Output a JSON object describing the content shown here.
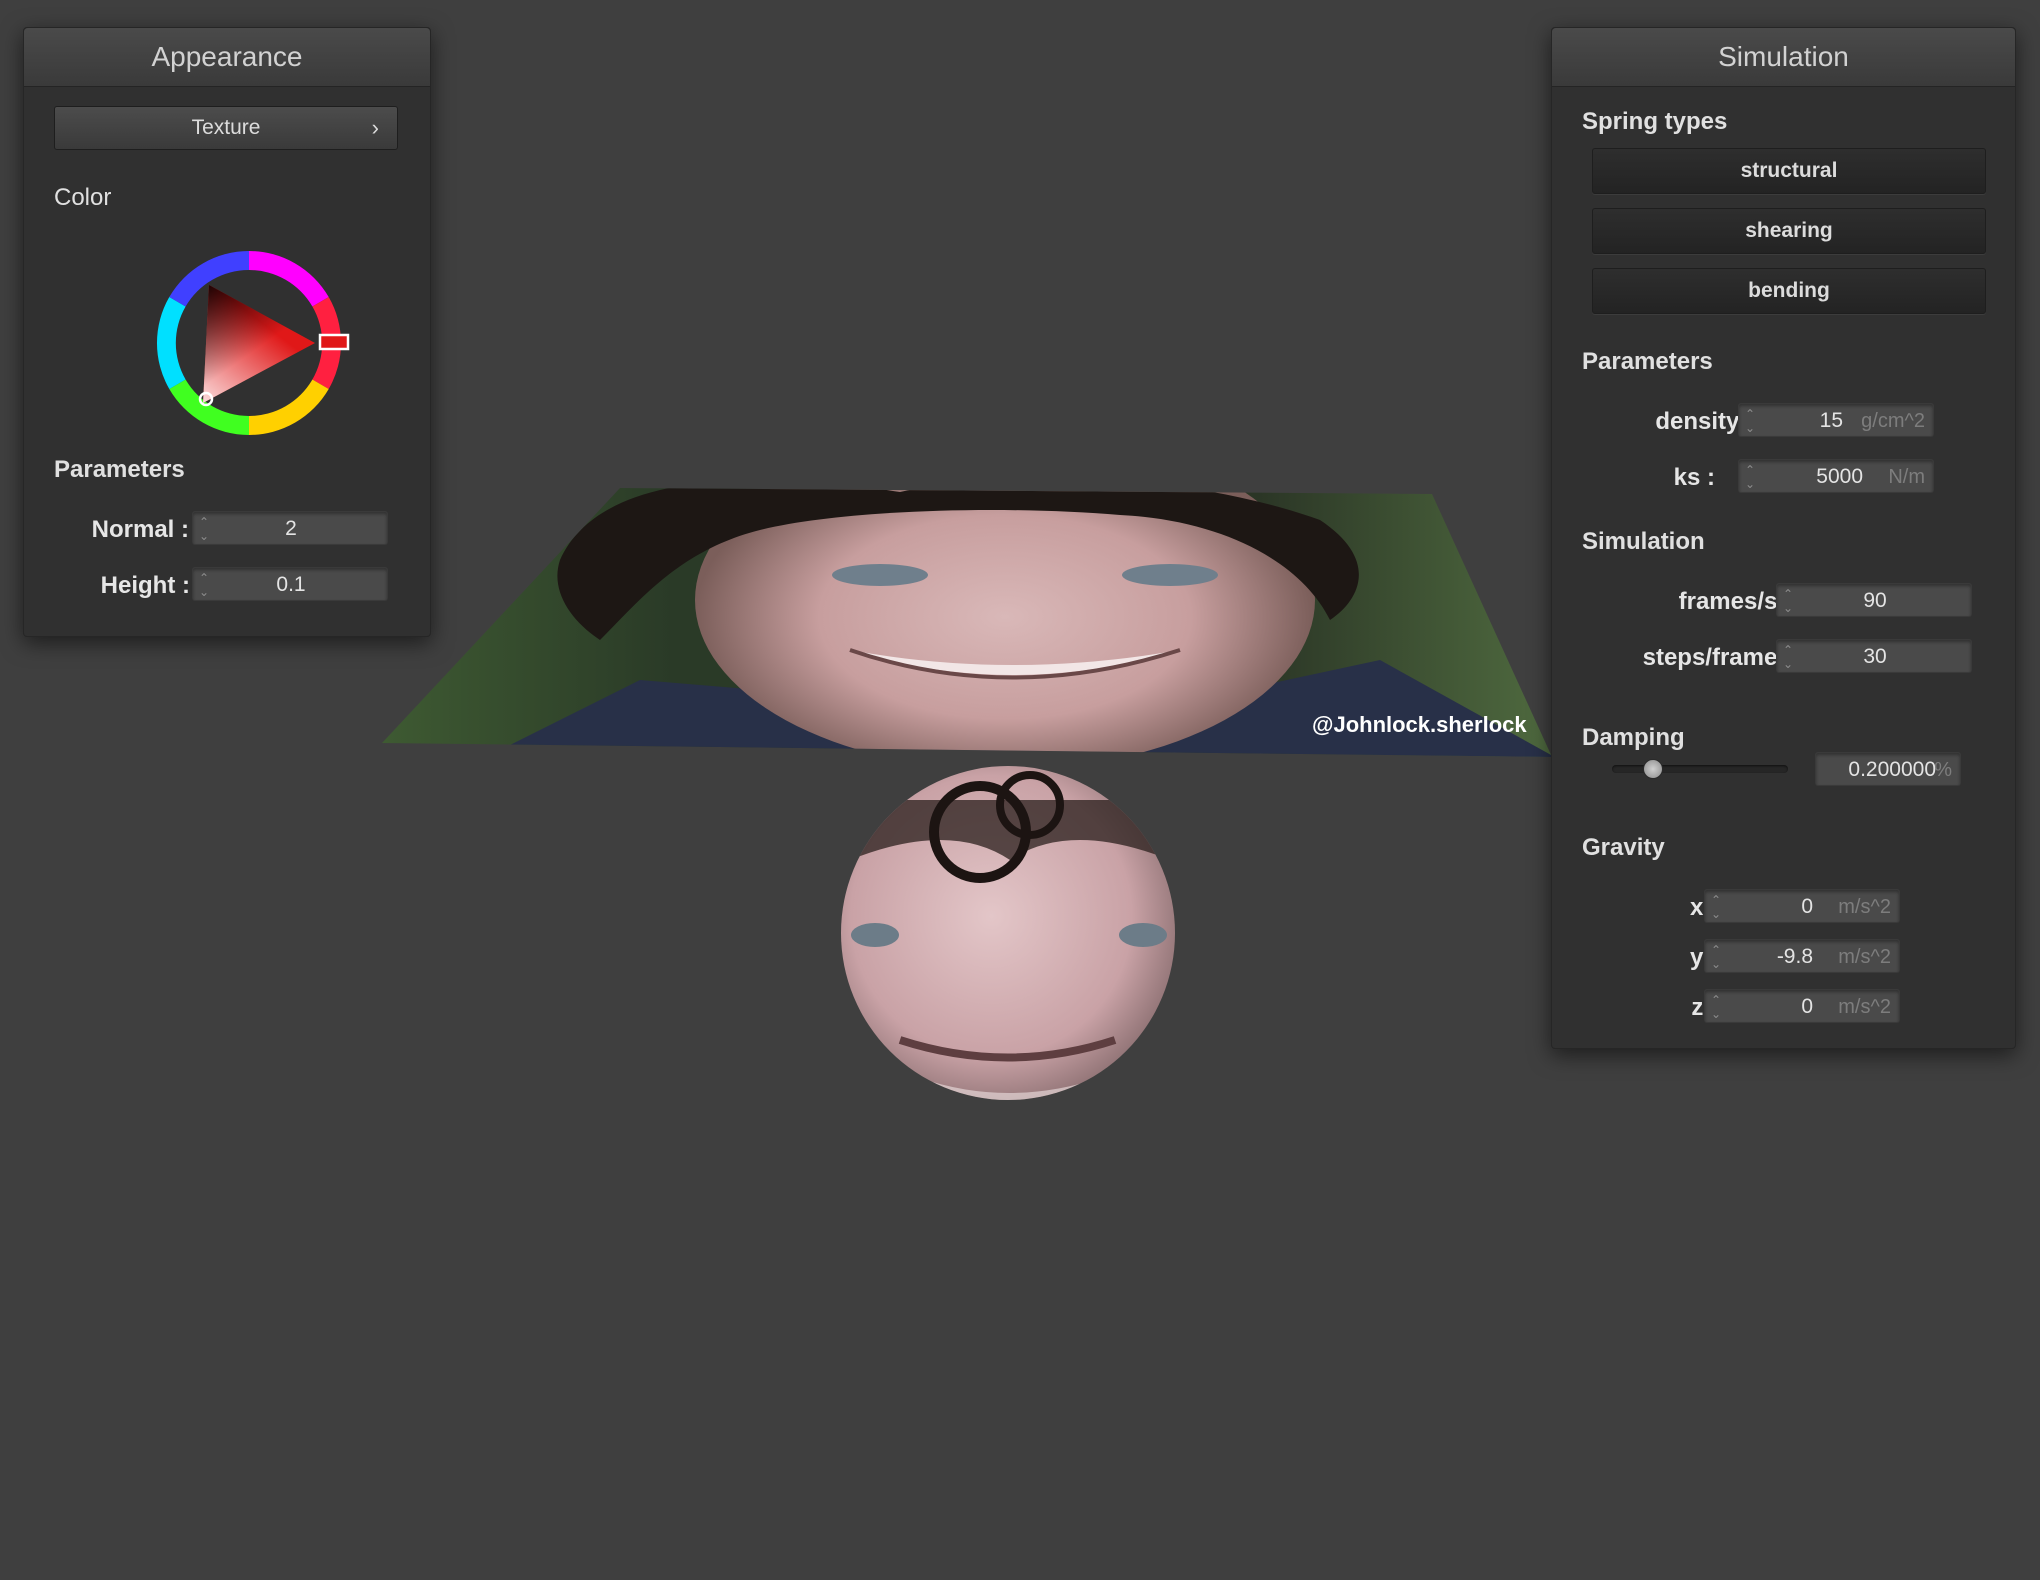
{
  "appearance": {
    "title": "Appearance",
    "texture_button": "Texture",
    "texture_chevron": "›",
    "color_title": "Color",
    "color_hue": "#ff0000",
    "parameters_title": "Parameters",
    "normal_label": "Normal :",
    "normal_value": "2",
    "height_label": "Height :",
    "height_value": "0.1"
  },
  "simulation_panel": {
    "title": "Simulation",
    "spring_types_title": "Spring types",
    "spring_buttons": [
      "structural",
      "shearing",
      "bending"
    ],
    "parameters_title": "Parameters",
    "density_label": "density :",
    "density_value": "15",
    "density_unit": "g/cm^2",
    "ks_label": "ks :",
    "ks_value": "5000",
    "ks_unit": "N/m",
    "simulation_title": "Simulation",
    "fps_label": "frames/s :",
    "fps_value": "90",
    "steps_label": "steps/frame :",
    "steps_value": "30",
    "damping_title": "Damping",
    "damping_value": "0.200000",
    "damping_unit": "%",
    "damping_level": 0.2,
    "gravity_title": "Gravity",
    "gx_label": "x :",
    "gx_value": "0",
    "gy_label": "y :",
    "gy_value": "-9.8",
    "gz_label": "z :",
    "gz_value": "0",
    "gravity_unit": "m/s^2"
  },
  "scene": {
    "cloth_watermark": "@Johnlock.sherlock"
  }
}
